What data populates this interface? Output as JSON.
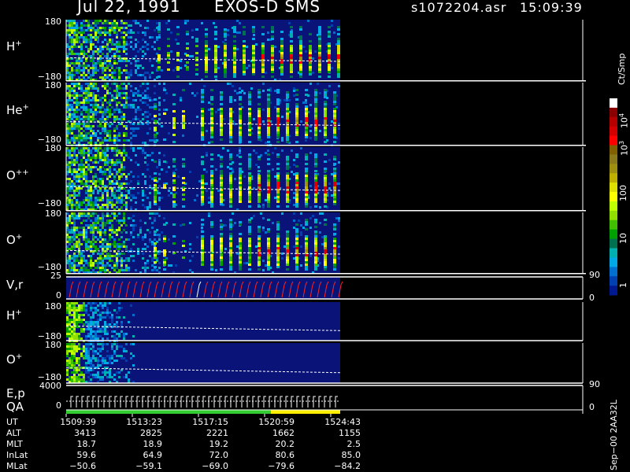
{
  "header": {
    "date": "Jul 22, 1991",
    "instrument": "EXOS-D SMS",
    "file": "s1072204.asr",
    "time": "15:09:39"
  },
  "panels": [
    {
      "id": "H+",
      "label": "H",
      "sup": "+",
      "ytop": "180",
      "ybot": "−180"
    },
    {
      "id": "He+",
      "label": "He",
      "sup": "+",
      "ytop": "180",
      "ybot": "−180"
    },
    {
      "id": "O++",
      "label": "O",
      "sup": "++",
      "ytop": "180",
      "ybot": "−180"
    },
    {
      "id": "O+",
      "label": "O",
      "sup": "+",
      "ytop": "180",
      "ybot": "−180"
    }
  ],
  "attitude_panel": {
    "label": "V,r",
    "ytop": "25",
    "ybot": "0",
    "rtop": "90",
    "rbot": "0"
  },
  "small_panels": [
    {
      "id": "H+ (2)",
      "label": "H",
      "sup": "+",
      "ytop": "180",
      "ybot": "−180"
    },
    {
      "id": "O+ (2)",
      "label": "O",
      "sup": "+",
      "ytop": "180",
      "ybot": "−180"
    }
  ],
  "energy_panel": {
    "label": "E,p",
    "label2": "QA",
    "ytop": "4000",
    "ybot": "0",
    "rtop": "90",
    "rbot": "0"
  },
  "colorbar": {
    "unit": "Ct/Smp",
    "labels": [
      {
        "base": "10",
        "exp": "4"
      },
      {
        "base": "10",
        "exp": "3"
      },
      {
        "base": "100",
        "exp": ""
      },
      {
        "base": "10",
        "exp": ""
      },
      {
        "base": "1",
        "exp": ""
      }
    ],
    "colors": [
      "#ffffff",
      "#8b0000",
      "#b40000",
      "#d20000",
      "#ff0000",
      "#806000",
      "#8a7a1a",
      "#a09010",
      "#c0b000",
      "#e0e000",
      "#ffff00",
      "#c0ff00",
      "#90e000",
      "#40c000",
      "#00a000",
      "#007050",
      "#00b0b0",
      "#00a8e8",
      "#0070d0",
      "#0040b0",
      "#001890"
    ]
  },
  "ephemeris": {
    "rows": [
      {
        "label": "UT",
        "values": [
          "1509:39",
          "1513:23",
          "1517:15",
          "1520:59",
          "1524:43"
        ]
      },
      {
        "label": "ALT",
        "values": [
          "3413",
          "2825",
          "2221",
          "1662",
          "1155"
        ]
      },
      {
        "label": "MLT",
        "values": [
          "18.7",
          "18.9",
          "19.2",
          "20.2",
          "2.5"
        ]
      },
      {
        "label": "InLat",
        "values": [
          "59.6",
          "64.9",
          "72.0",
          "80.6",
          "85.0"
        ]
      },
      {
        "label": "MLat",
        "values": [
          "−50.6",
          "−59.1",
          "−69.0",
          "−79.6",
          "−84.2"
        ]
      }
    ]
  },
  "footer_vertical": "Sep−00  2AA32L",
  "colors": {
    "background": "#000000",
    "panel_fill": "#0a1478",
    "axis": "#ffffff",
    "attitude_trace": "#ff2020",
    "qa_bar_green": "#33cc33",
    "qa_bar_yellow": "#ffee00"
  }
}
